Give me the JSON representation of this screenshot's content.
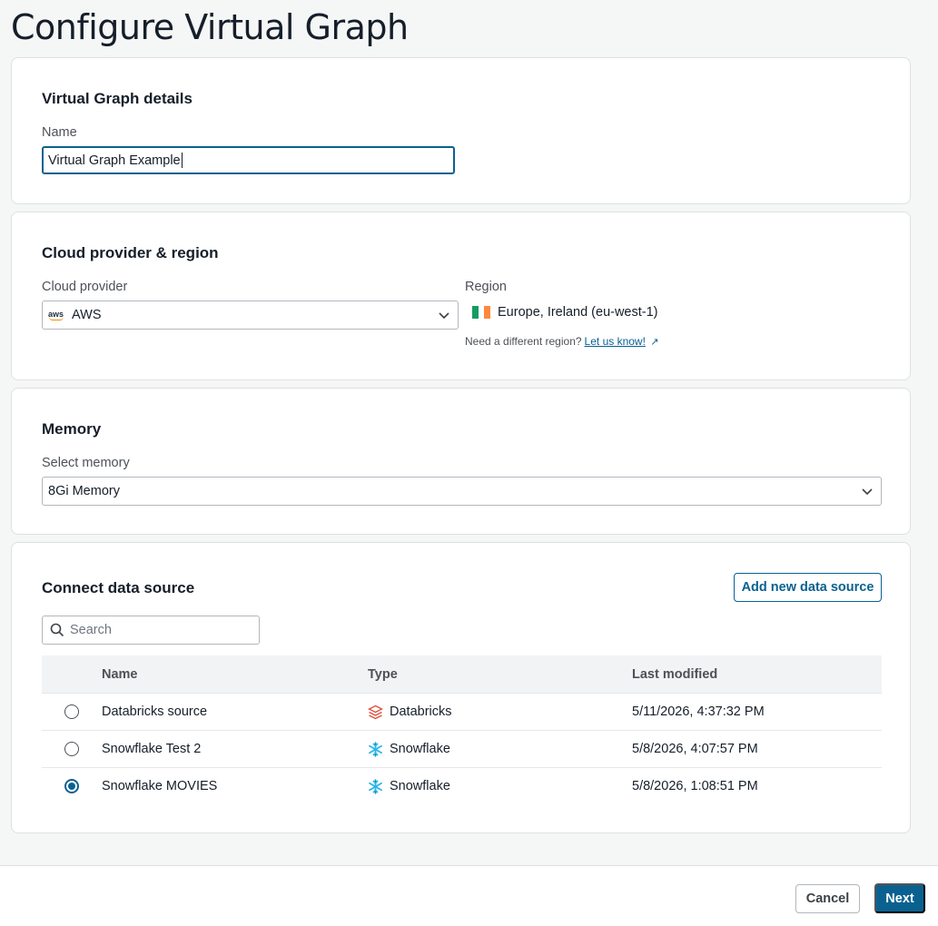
{
  "page": {
    "title": "Configure Virtual Graph"
  },
  "details": {
    "title": "Virtual Graph details",
    "name_label": "Name",
    "name_value": "Virtual Graph Example"
  },
  "cloud": {
    "title": "Cloud provider & region",
    "provider_label": "Cloud provider",
    "provider_logo_text": "aws",
    "provider_value": "AWS",
    "region_label": "Region",
    "region_value": "Europe, Ireland (eu-west-1)",
    "region_hint": "Need a different region?",
    "region_link": "Let us know!",
    "region_link_icon": "↗"
  },
  "memory": {
    "title": "Memory",
    "select_label": "Select memory",
    "select_value": "8Gi Memory"
  },
  "datasource": {
    "title": "Connect data source",
    "add_button": "Add new data source",
    "search_placeholder": "Search",
    "columns": {
      "name": "Name",
      "type": "Type",
      "modified": "Last modified"
    },
    "rows": [
      {
        "name": "Databricks source",
        "type": "Databricks",
        "type_icon": "databricks-icon",
        "modified": "5/11/2026, 4:37:32 PM",
        "selected": false
      },
      {
        "name": "Snowflake Test 2",
        "type": "Snowflake",
        "type_icon": "snowflake-icon",
        "modified": "5/8/2026, 4:07:57 PM",
        "selected": false
      },
      {
        "name": "Snowflake MOVIES",
        "type": "Snowflake",
        "type_icon": "snowflake-icon",
        "modified": "5/8/2026, 1:08:51 PM",
        "selected": true
      }
    ]
  },
  "footer": {
    "cancel": "Cancel",
    "next": "Next"
  },
  "colors": {
    "primary": "#0a6190",
    "databricks": "#e0503f",
    "snowflake": "#29b5e8"
  }
}
